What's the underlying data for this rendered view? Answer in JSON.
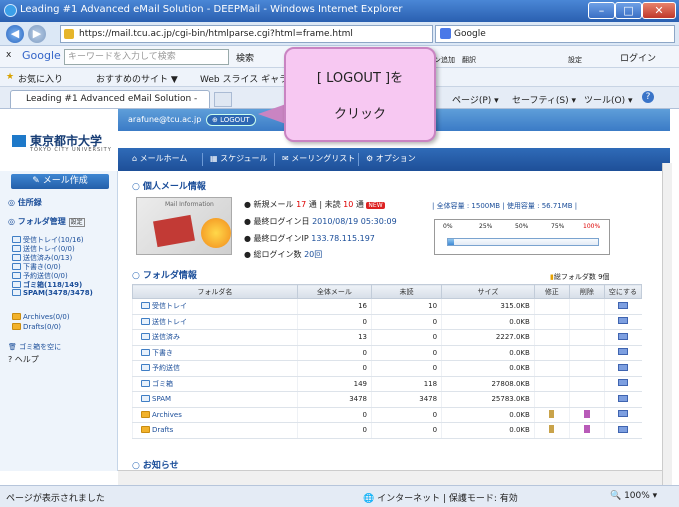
{
  "window": {
    "title": "Leading #1 Advanced eMail Solution - DEEPMail - Windows Internet Explorer",
    "min": "–",
    "max": "□",
    "close": "✕"
  },
  "address": {
    "url": "https://mail.tcu.ac.jp/cgi-bin/htmlparse.cgi?html=frame.html",
    "search_engine": "Google"
  },
  "googlebar": {
    "close": "x",
    "label": "Google",
    "placeholder": "キーワードを入力して検索",
    "search_label": "検索",
    "button_add": "ボタン追加",
    "translate": "翻訳",
    "settings": "設定",
    "login": "ログイン"
  },
  "favbar": {
    "favorites": "お気に入り",
    "recommended": "おすすめのサイト ▼",
    "webslice": "Web スライス ギャラ"
  },
  "tabbar": {
    "tab_title": "Leading #1 Advanced eMail Solution - DEEP...",
    "page_menu": "ページ(P) ▾",
    "safety_menu": "セーフティ(S) ▾",
    "tools_menu": "ツール(O) ▾",
    "help": "?"
  },
  "mailbar": {
    "user": "arafune@tcu.ac.jp",
    "logout": "LOGOUT"
  },
  "logo": {
    "name": "東京都市大学",
    "sub": "TOKYO CITY UNIVERSITY"
  },
  "menu": {
    "home": "メールホーム",
    "schedule": "スケジュール",
    "mailing_list": "メーリングリスト",
    "options": "オプション"
  },
  "sidebar": {
    "compose": "メール作成",
    "address_book": "住所録",
    "folder_manage": "フォルダ管理",
    "folder_manage_badge": "設定",
    "folders": [
      {
        "label": "受信トレイ",
        "count": "(10/16)"
      },
      {
        "label": "送信トレイ",
        "count": "(0/0)"
      },
      {
        "label": "送信済み",
        "count": "(0/13)"
      },
      {
        "label": "下書き",
        "count": "(0/0)"
      },
      {
        "label": "予約送信",
        "count": "(0/0)"
      },
      {
        "label": "ゴミ箱",
        "count": "(118/149)"
      },
      {
        "label": "SPAM",
        "count": "(3478/3478)"
      }
    ],
    "user_folders": [
      {
        "label": "Archives",
        "count": "(0/0)"
      },
      {
        "label": "Drafts",
        "count": "(0/0)"
      }
    ],
    "empty_trash": "ゴミ箱を空に",
    "help": "ヘルプ"
  },
  "info": {
    "title": "個人メール情報",
    "image_caption": "Mail Information",
    "new_mail_label": "新規メール",
    "new_mail_count": "17",
    "unread_label": "未読",
    "unread_count": "10",
    "last_login_label": "最終ログイン日",
    "last_login": "2010/08/19 05:30:09",
    "last_ip_label": "最終ログインIP",
    "last_ip": "133.78.115.197",
    "total_logins_label": "総ログイン数",
    "total_logins": "20回",
    "quota_total_label": "全体容量",
    "quota_total": "1500MB",
    "quota_used_label": "使用容量",
    "quota_used": "56.71MB",
    "meter_ticks": [
      "0%",
      "25%",
      "50%",
      "75%",
      "100%"
    ],
    "meter_fill_percent": 3.8
  },
  "folders": {
    "title": "フォルダ情報",
    "summary": "総フォルダ数 9個",
    "headers": [
      "フォルダ名",
      "全体メール",
      "未読",
      "サイズ",
      "修正",
      "削除",
      "空にする"
    ],
    "rows": [
      {
        "name": "受信トレイ",
        "total": "16",
        "unread": "10",
        "size": "315.0KB",
        "editable": false
      },
      {
        "name": "送信トレイ",
        "total": "0",
        "unread": "0",
        "size": "0.0KB",
        "editable": false
      },
      {
        "name": "送信済み",
        "total": "13",
        "unread": "0",
        "size": "2227.0KB",
        "editable": false
      },
      {
        "name": "下書き",
        "total": "0",
        "unread": "0",
        "size": "0.0KB",
        "editable": false
      },
      {
        "name": "予約送信",
        "total": "0",
        "unread": "0",
        "size": "0.0KB",
        "editable": false
      },
      {
        "name": "ゴミ箱",
        "total": "149",
        "unread": "118",
        "size": "27808.0KB",
        "editable": false
      },
      {
        "name": "SPAM",
        "total": "3478",
        "unread": "3478",
        "size": "25783.0KB",
        "editable": false
      },
      {
        "name": "Archives",
        "total": "0",
        "unread": "0",
        "size": "0.0KB",
        "editable": true
      },
      {
        "name": "Drafts",
        "total": "0",
        "unread": "0",
        "size": "0.0KB",
        "editable": true
      }
    ]
  },
  "notice": {
    "title": "お知らせ"
  },
  "callout": {
    "line1": "[ LOGOUT ]を",
    "line2": "クリック"
  },
  "status": {
    "left": "ページが表示されました",
    "zone": "インターネット | 保護モード: 有効",
    "zoom": "100%"
  },
  "colors": {
    "accent": "#2f6bb8",
    "callout_bg": "#f7c8f2",
    "callout_border": "#c984c2",
    "alert": "#dd0000"
  }
}
